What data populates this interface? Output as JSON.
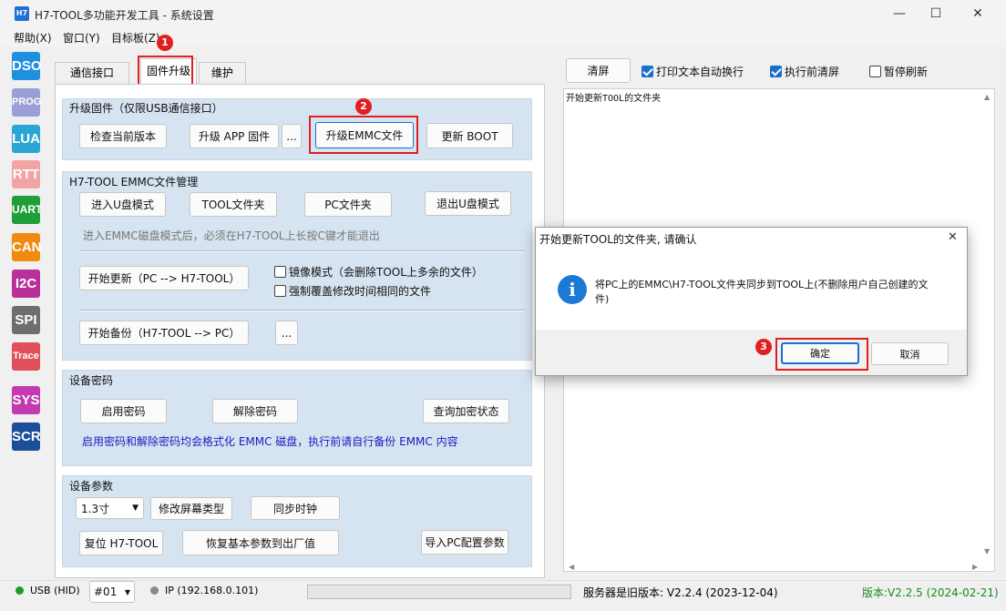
{
  "window": {
    "app_icon": "H7",
    "title": "H7-TOOL多功能开发工具 - 系统设置",
    "minimize": "—",
    "maximize": "☐",
    "close": "✕"
  },
  "menu": [
    "帮助(X)",
    "窗口(Y)",
    "目标板(Z)"
  ],
  "toolbar_icons": [
    {
      "label": "DSO",
      "color": "#1f8fe0"
    },
    {
      "label": "PROG",
      "color": "#9a9fd8"
    },
    {
      "label": "LUA",
      "color": "#2aa6d6"
    },
    {
      "label": "RTT",
      "color": "#f2a3a3"
    },
    {
      "label": "UART",
      "color": "#1f9e3a"
    },
    {
      "label": "CAN",
      "color": "#f08a10"
    },
    {
      "label": "I2C",
      "color": "#b8309a"
    },
    {
      "label": "SPI",
      "color": "#6e6e6e"
    },
    {
      "label": "Trace",
      "color": "#e0505a"
    },
    {
      "label": "SYS",
      "color": "#c43ab0"
    },
    {
      "label": "SCR",
      "color": "#1b4f9a"
    }
  ],
  "tabs": [
    "通信接口",
    "固件升级",
    "维护"
  ],
  "upgrade": {
    "title": "升级固件（仅限USB通信接口）",
    "check_version": "检查当前版本",
    "upgrade_app": "升级 APP 固件",
    "browse": "...",
    "upgrade_emmc": "升级EMMC文件",
    "update_boot": "更新 BOOT"
  },
  "emmc": {
    "title": "H7-TOOL EMMC文件管理",
    "enter_udisk": "进入U盘模式",
    "tool_folder": "TOOL文件夹",
    "pc_folder": "PC文件夹",
    "exit_udisk": "退出U盘模式",
    "hint": "进入EMMC磁盘模式后，必须在H7-TOOL上长按C键才能退出",
    "start_update": "开始更新（PC --> H7-TOOL）",
    "mirror_mode": "镜像模式（会删除TOOL上多余的文件）",
    "force_overwrite": "强制覆盖修改时间相同的文件",
    "start_backup": "开始备份（H7-TOOL --> PC）",
    "browse": "..."
  },
  "password": {
    "title": "设备密码",
    "enable": "启用密码",
    "disable": "解除密码",
    "query": "查询加密状态",
    "hint": "启用密码和解除密码均会格式化 EMMC 磁盘，执行前请自行备份 EMMC 内容"
  },
  "params": {
    "title": "设备参数",
    "screen_size": "1.3寸",
    "modify_screen": "修改屏幕类型",
    "sync_clock": "同步时钟",
    "reset_tool": "复位 H7-TOOL",
    "restore_defaults": "恢复基本参数到出厂值",
    "import_pc": "导入PC配置参数"
  },
  "right_panel": {
    "clear": "清屏",
    "wrap_label": "打印文本自动换行",
    "wrap_checked": true,
    "clear_before_label": "执行前清屏",
    "clear_before_checked": true,
    "pause_label": "暂停刷新",
    "pause_checked": false,
    "log": "开始更新TOOL的文件夹"
  },
  "dialog": {
    "title": "开始更新TOOL的文件夹, 请确认",
    "close": "✕",
    "message_line1": "将PC上的EMMC\\H7-TOOL文件夹同步到TOOL上(不删除用户自己创建的文",
    "message_line2": "件)",
    "ok": "确定",
    "cancel": "取消"
  },
  "annotations": [
    "1",
    "2",
    "3"
  ],
  "status": {
    "usb": "USB (HID)",
    "usb_color": "#1a9e2a",
    "device_no": "#01",
    "ip": "IP (192.168.0.101)",
    "ip_color": "#888888",
    "server_version": "服务器是旧版本: V2.2.4 (2023-12-04)",
    "local_version": "版本:V2.2.5 (2024-02-21)",
    "local_version_color": "#1a8a1a"
  }
}
